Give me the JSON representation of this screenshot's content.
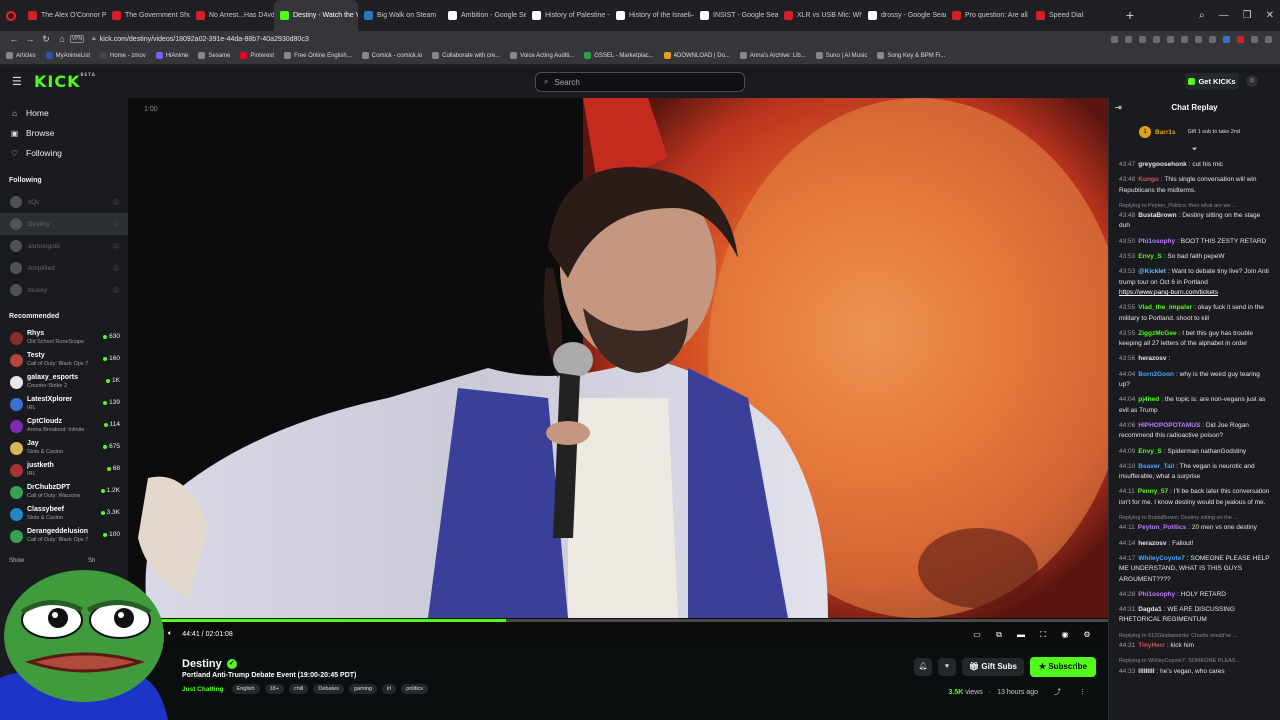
{
  "browser": {
    "tabs": [
      {
        "title": "The Alex O'Connor Podcast",
        "fav": "#d21f2a"
      },
      {
        "title": "The Government Shutdow",
        "fav": "#d21f2a"
      },
      {
        "title": "No Arrest...Has D4vd Bee",
        "fav": "#d21f2a"
      },
      {
        "title": "Destiny - Watch the VOD",
        "fav": "#53fc18",
        "active": true
      },
      {
        "title": "Big Walk on Steam",
        "fav": "#2a75bb"
      },
      {
        "title": "Ambition - Google Search",
        "fav": "#ffffff"
      },
      {
        "title": "History of Palestine - Wiki",
        "fav": "#ffffff"
      },
      {
        "title": "History of the Israeli–Pale",
        "fav": "#ffffff"
      },
      {
        "title": "INSIST - Google Search",
        "fav": "#ffffff"
      },
      {
        "title": "XLR vs USB Mic: Which Sh",
        "fav": "#d21f2a"
      },
      {
        "title": "drossy - Google Search",
        "fav": "#ffffff"
      },
      {
        "title": "Pro question: Are all mics",
        "fav": "#d21f2a"
      },
      {
        "title": "Speed Dial",
        "fav": "#d21f2a"
      }
    ],
    "url": "kick.com/destiny/videos/18092a02-391e-44da-88b7-40a2930d80c3",
    "bookmarks": [
      {
        "label": "Articles",
        "color": "#888"
      },
      {
        "label": "MyAnimeList",
        "color": "#2e51a2"
      },
      {
        "label": "Home - zmov",
        "color": "#444"
      },
      {
        "label": "HiAnime",
        "color": "#7a5cff"
      },
      {
        "label": "Sesame",
        "color": "#888"
      },
      {
        "label": "Pinterest",
        "color": "#e60023"
      },
      {
        "label": "Free Online English...",
        "color": "#888"
      },
      {
        "label": "Comick - comick.io",
        "color": "#888"
      },
      {
        "label": "Collaborate with cre...",
        "color": "#888"
      },
      {
        "label": "Voice Acting Auditi...",
        "color": "#888"
      },
      {
        "label": "GSSEL - Marketplac...",
        "color": "#2ea043"
      },
      {
        "label": "4DOWNLOAD | Do...",
        "color": "#e0a21a"
      },
      {
        "label": "Anna's Archive: Lib...",
        "color": "#888"
      },
      {
        "label": "Suno | AI Music",
        "color": "#888"
      },
      {
        "label": "Song Key & BPM Fi...",
        "color": "#888"
      }
    ]
  },
  "header": {
    "logo": "KICK",
    "logo_beta": "BETA",
    "search_placeholder": "Search",
    "get_kicks": "Get KICKs"
  },
  "sidebar": {
    "nav": [
      {
        "label": "Home",
        "icon": "⌂"
      },
      {
        "label": "Browse",
        "icon": "▣"
      },
      {
        "label": "Following",
        "icon": "♡"
      }
    ],
    "following_heading": "Following",
    "following": [
      "xQc",
      "Destiny",
      "asmongold",
      "Amplified",
      "fousey"
    ],
    "recommended_heading": "Recommended",
    "recommended": [
      {
        "name": "Rhys",
        "category": "Old School RuneScape",
        "viewers": "630",
        "color": "#8a2b2b"
      },
      {
        "name": "Testy",
        "category": "Call of Duty: Black Ops 7",
        "viewers": "160",
        "color": "#b3453a"
      },
      {
        "name": "galaxy_esports",
        "category": "Counter-Strike 2",
        "viewers": "1K",
        "color": "#e8e8e8"
      },
      {
        "name": "LatestXplorer",
        "category": "IRL",
        "viewers": "139",
        "color": "#3b6fd1"
      },
      {
        "name": "CptCloudz",
        "category": "Arena Breakout: Infinite",
        "viewers": "114",
        "color": "#7d2bb0"
      },
      {
        "name": "Jay",
        "category": "Slots & Casino",
        "viewers": "675",
        "color": "#d8b45a"
      },
      {
        "name": "justketh",
        "category": "IRL",
        "viewers": "68",
        "color": "#a33"
      },
      {
        "name": "DrChubzDPT",
        "category": "Call of Duty: Warzone",
        "viewers": "1.2K",
        "color": "#3aa153"
      },
      {
        "name": "Classybeef",
        "category": "Slots & Casino",
        "viewers": "3.3K",
        "color": "#1e88c8"
      },
      {
        "name": "Derangeddelusion",
        "category": "Call of Duty: Black Ops 7",
        "viewers": "100",
        "color": "#3aa153"
      }
    ],
    "show_more": "Show",
    "show_less": "Sh"
  },
  "video": {
    "top_left_time": "1:00",
    "current": "44:41",
    "duration": "02:01:08",
    "progress": 0.3694
  },
  "channel": {
    "name": "Destiny",
    "title": "Portland Anti-Trump Debate Event (19:00-20:45 PDT)",
    "category": "Just Chatting",
    "tags": [
      "English",
      "18+",
      "chill",
      "Debates",
      "gaming",
      "irl",
      "politics"
    ],
    "gift_subs": "Gift Subs",
    "subscribe": "Subscribe",
    "views": "3.5K",
    "views_label": "views",
    "ago": "13 hours ago"
  },
  "chat": {
    "title": "Chat Replay",
    "pinned_user": "Barr1s",
    "pinned_text": "Gift 1 sub to take 2nd",
    "messages": [
      {
        "time": "43:47",
        "user": "greygoosehonk",
        "color": "#e6e6e6",
        "text": "cut his mic"
      },
      {
        "time": "43:48",
        "user": "Kungo",
        "color": "#d9534f",
        "text": "This single conversation will win Republicans the midterms."
      },
      {
        "reply": "Replying to Peyton_Politics: then what are we ...",
        "time": "43:48",
        "user": "BustaBrown",
        "color": "#e6e6e6",
        "text": "Destiny sitting on the stage duh"
      },
      {
        "time": "43:50",
        "user": "Phi1osophy",
        "color": "#c07cff",
        "text": "BOOT THIS ZESTY RETARD"
      },
      {
        "time": "43:53",
        "user": "Envy_S",
        "color": "#53fc18",
        "text": "So bad faith pepeW"
      },
      {
        "time": "43:53",
        "user": "@Kicklet",
        "color": "#6ec1ff",
        "text": "Want to debate tiny live? Join Anti trump tour on Oct 6 in Portland",
        "link": "https://www.pang-burn.com/tickets"
      },
      {
        "time": "43:55",
        "user": "Vlad_the_impaler",
        "color": "#53fc18",
        "text": "okay fuck it send in the military to Portland. shoot to kill"
      },
      {
        "time": "43:55",
        "user": "ZiggzMcGee",
        "color": "#53fc18",
        "text": "I bet this guy has trouble keeping all 27 letters of the alphabet in order"
      },
      {
        "time": "43:56",
        "user": "herazosv",
        "color": "#e6e6e6",
        "text": ""
      },
      {
        "time": "44:04",
        "user": "Born2Goon",
        "color": "#4aa3ff",
        "text": "why is the weird guy tearing up?"
      },
      {
        "time": "44:04",
        "user": "pj4hed",
        "color": "#53fc18",
        "text": "the topic is: are non-vegans just as evil as Trump"
      },
      {
        "time": "44:06",
        "user": "HIPHOPOPOTAMUS",
        "color": "#c07cff",
        "text": "Did Joe Rogan recommend this radioactive poison?"
      },
      {
        "time": "44:09",
        "user": "Envy_S",
        "color": "#53fc18",
        "text": "Spiderman nathanGodstiny"
      },
      {
        "time": "44:10",
        "user": "Beaver_Tail",
        "color": "#4aa3ff",
        "text": "The vegan is neurotic and insufferable, what a surprise"
      },
      {
        "time": "44:11",
        "user": "Penny_57",
        "color": "#53fc18",
        "text": "I'll be back later this conversation isn't for me. I know destiny would be jealous of me."
      },
      {
        "reply": "Replying to BustaBrown: Destiny sitting on the ...",
        "time": "44:11",
        "user": "Peyton_Politics",
        "color": "#c07cff",
        "text": "20 men vs one destiny"
      },
      {
        "time": "44:14",
        "user": "herazosv",
        "color": "#e6e6e6",
        "text": "Fallout!"
      },
      {
        "time": "44:17",
        "user": "WhileyCoyote7",
        "color": "#4aa3ff",
        "text": "SOMEONE PLEASE HELP ME UNDERSTAND, WHAT IS THIS GUYS ARGUMENT????"
      },
      {
        "time": "44:28",
        "user": "Phi1osophy",
        "color": "#c07cff",
        "text": "HOLY RETARD"
      },
      {
        "time": "44:31",
        "user": "Dagda1",
        "color": "#e6e6e6",
        "text": "WE ARE DISCUSSING RHETORICAL REGIMENTUM"
      },
      {
        "reply": "Replying to 612Glodaweirda: Charlie would've ...",
        "time": "44:31",
        "user": "TinyHerr",
        "color": "#d9534f",
        "text": "kick him"
      },
      {
        "reply": "Replying to WhileyCoyote7: SOMEONE PLEAS...",
        "time": "44:33",
        "user": "IIIIIIIII",
        "color": "#e6e6e6",
        "text": "he's vegan, who cares"
      }
    ]
  }
}
